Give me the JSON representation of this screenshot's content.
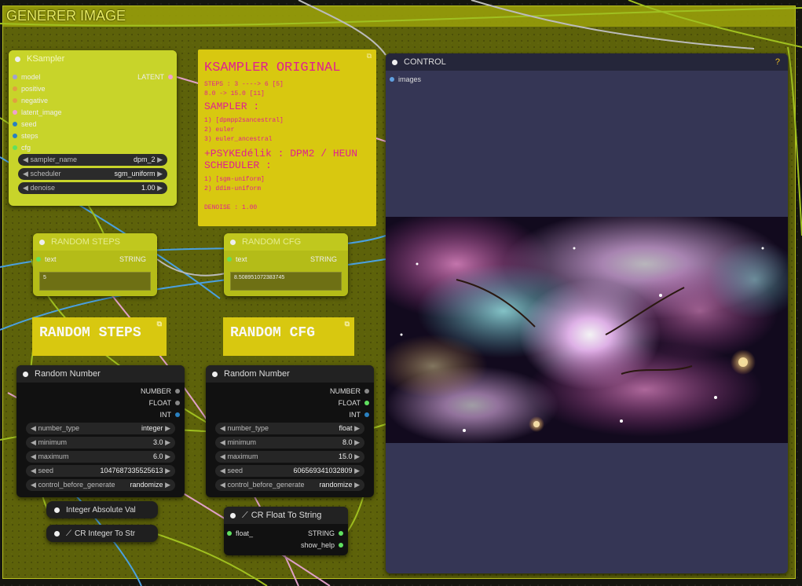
{
  "group": {
    "title": "GENERER IMAGE"
  },
  "ksampler": {
    "title": "KSampler",
    "inputs": [
      "model",
      "positive",
      "negative",
      "latent_image",
      "seed",
      "steps",
      "cfg"
    ],
    "output": "LATENT",
    "widgets": [
      {
        "label": "sampler_name",
        "value": "dpm_2"
      },
      {
        "label": "scheduler",
        "value": "sgm_uniform"
      },
      {
        "label": "denoise",
        "value": "1.00"
      }
    ]
  },
  "note_original": {
    "title": "KSAMPLER ORIGINAL",
    "steps": "STEPS : 3 ----> 6 [5]",
    "cfg": "8.0 -> 15.0 [11]",
    "sampler_head": "SAMPLER :",
    "sampler_1": "1) [dpmpp2sancestral]",
    "sampler_2": "2) euler",
    "sampler_3": "3) euler_ancestral",
    "psyke": "+PSYKEdélik : DPM2 / HEUN",
    "scheduler_head": "SCHEDULER :",
    "scheduler_1": "1) [sgm-uniform]",
    "scheduler_2": "2) ddim-uniform",
    "denoise": "DENOISE : 1.00"
  },
  "random_steps_node": {
    "title": "RANDOM STEPS",
    "input": "text",
    "output": "STRING",
    "value": "5"
  },
  "random_cfg_node": {
    "title": "RANDOM CFG",
    "input": "text",
    "output": "STRING",
    "value": "8.508951072383745"
  },
  "label_steps": "RANDOM STEPS",
  "label_cfg": "RANDOM CFG",
  "random_number_1": {
    "title": "Random Number",
    "outputs": [
      "NUMBER",
      "FLOAT",
      "INT"
    ],
    "widgets": [
      {
        "label": "number_type",
        "value": "integer"
      },
      {
        "label": "minimum",
        "value": "3.0"
      },
      {
        "label": "maximum",
        "value": "6.0"
      },
      {
        "label": "seed",
        "value": "1047687335525613"
      },
      {
        "label": "control_before_generate",
        "value": "randomize"
      }
    ]
  },
  "random_number_2": {
    "title": "Random Number",
    "outputs": [
      "NUMBER",
      "FLOAT",
      "INT"
    ],
    "widgets": [
      {
        "label": "number_type",
        "value": "float"
      },
      {
        "label": "minimum",
        "value": "8.0"
      },
      {
        "label": "maximum",
        "value": "15.0"
      },
      {
        "label": "seed",
        "value": "606569341032809"
      },
      {
        "label": "control_before_generate",
        "value": "randomize"
      }
    ]
  },
  "int_abs": {
    "title": "Integer Absolute Val"
  },
  "cr_int": {
    "title": "CR Integer To Str"
  },
  "cr_float": {
    "title": "CR Float To String",
    "input": "float_",
    "outputs": [
      "STRING",
      "show_help"
    ]
  },
  "control": {
    "title": "CONTROL",
    "help": "?",
    "input": "images"
  },
  "colors": {
    "group": "#7a8008",
    "note": "#d8c810",
    "note_text": "#e0208f",
    "control_bg": "#353655"
  }
}
